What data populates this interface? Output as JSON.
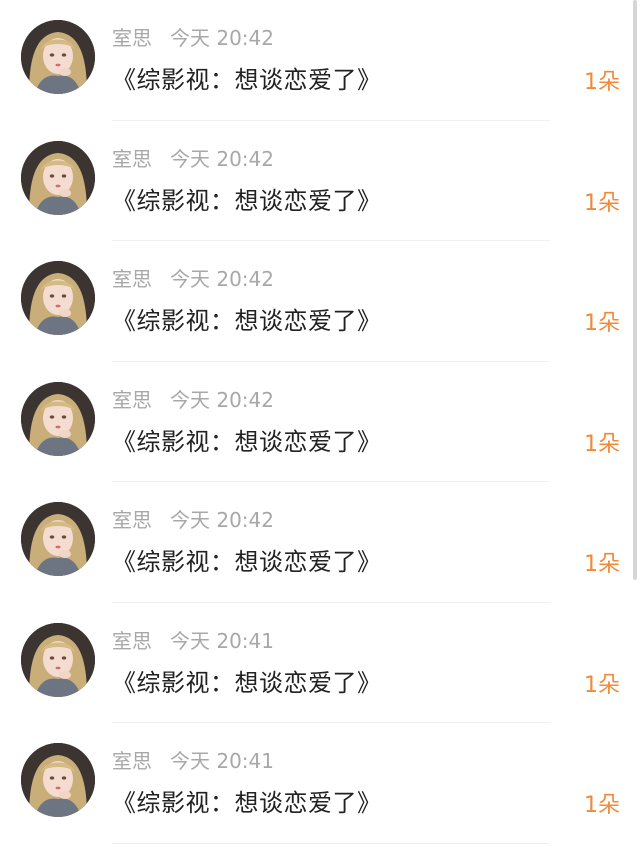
{
  "items": [
    {
      "name": "室思",
      "time": "今天 20:42",
      "title": "《综影视：想谈恋爱了》",
      "gift": "1朵"
    },
    {
      "name": "室思",
      "time": "今天 20:42",
      "title": "《综影视：想谈恋爱了》",
      "gift": "1朵"
    },
    {
      "name": "室思",
      "time": "今天 20:42",
      "title": "《综影视：想谈恋爱了》",
      "gift": "1朵"
    },
    {
      "name": "室思",
      "time": "今天 20:42",
      "title": "《综影视：想谈恋爱了》",
      "gift": "1朵"
    },
    {
      "name": "室思",
      "time": "今天 20:42",
      "title": "《综影视：想谈恋爱了》",
      "gift": "1朵"
    },
    {
      "name": "室思",
      "time": "今天 20:41",
      "title": "《综影视：想谈恋爱了》",
      "gift": "1朵"
    },
    {
      "name": "室思",
      "time": "今天 20:41",
      "title": "《综影视：想谈恋爱了》",
      "gift": "1朵"
    }
  ],
  "colors": {
    "accent": "#f08a3a",
    "meta_text": "#a8a8a8",
    "title_text": "#222222",
    "divider": "#f0f0f0"
  },
  "icons": {
    "avatar": "user-avatar-illustration"
  }
}
